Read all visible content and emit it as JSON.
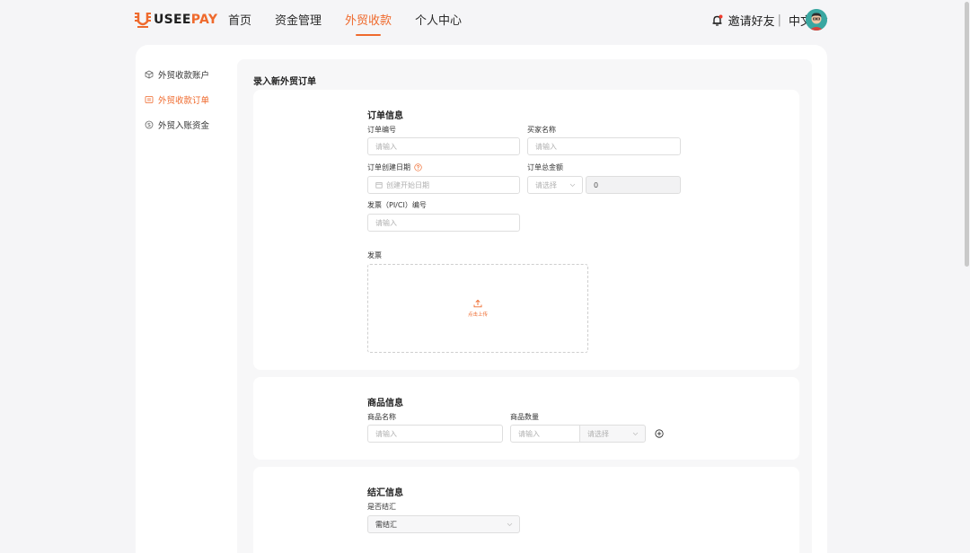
{
  "header": {
    "logo": {
      "brand_u": "USEE",
      "brand_p": "PAY"
    },
    "nav": [
      {
        "label": "首页",
        "active": false
      },
      {
        "label": "资金管理",
        "active": false
      },
      {
        "label": "外贸收款",
        "active": true
      },
      {
        "label": "个人中心",
        "active": false
      }
    ],
    "invite": "邀请好友",
    "separator": "|",
    "language": "中文"
  },
  "sidebar": {
    "items": [
      {
        "label": "外贸收款账户",
        "icon": "cube-icon",
        "active": false
      },
      {
        "label": "外贸收款订单",
        "icon": "list-icon",
        "active": true
      },
      {
        "label": "外贸入账资金",
        "icon": "dollar-icon",
        "active": false
      }
    ]
  },
  "page": {
    "title": "录入新外贸订单"
  },
  "order_info": {
    "title": "订单信息",
    "order_no": {
      "label": "订单编号",
      "placeholder": "请输入"
    },
    "buyer_name": {
      "label": "买家名称",
      "placeholder": "请输入"
    },
    "created_date": {
      "label": "订单创建日期",
      "placeholder": "创建开始日期"
    },
    "total_amount": {
      "label": "订单总金额",
      "currency_placeholder": "请选择",
      "value": "0"
    },
    "invoice_no": {
      "label": "发票（PI/CI）编号",
      "placeholder": "请输入"
    },
    "invoice": {
      "label": "发票",
      "upload_text": "点击上传"
    }
  },
  "goods_info": {
    "title": "商品信息",
    "name": {
      "label": "商品名称",
      "placeholder": "请输入"
    },
    "quantity": {
      "label": "商品数量",
      "placeholder": "请输入",
      "unit_placeholder": "请选择"
    }
  },
  "settlement_info": {
    "title": "结汇信息",
    "need_settle": {
      "label": "是否结汇",
      "value": "需结汇"
    }
  },
  "colors": {
    "accent": "#ef6a2d",
    "page_bg": "#f5f5f7",
    "card_bg": "#ffffff"
  }
}
